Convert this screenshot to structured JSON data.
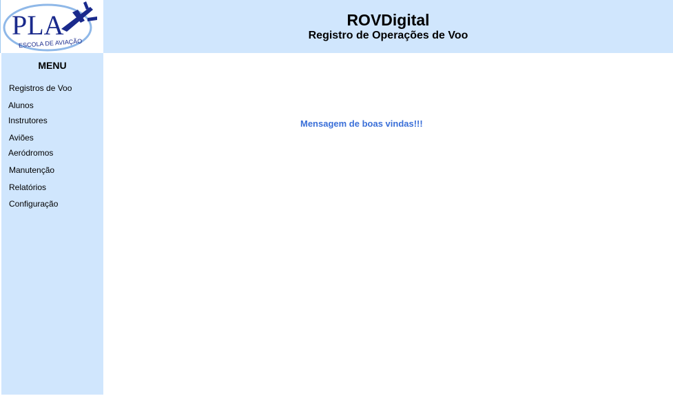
{
  "logo": {
    "text": "PLA",
    "tagline": "ESCOLA DE AVIAÇÃO",
    "icon": "airplane-icon",
    "color": "#1a2a8c",
    "ring_color": "#8fb8e8"
  },
  "header": {
    "title": "ROVDigital",
    "subtitle": "Registro de Operações de Voo"
  },
  "sidebar": {
    "title": "MENU",
    "items": [
      {
        "label": "Registros de Voo"
      },
      {
        "label": "Alunos"
      },
      {
        "label": "Instrutores"
      },
      {
        "label": "Aviões"
      },
      {
        "label": "Aeródromos"
      },
      {
        "label": "Manutenção"
      },
      {
        "label": "Relatórios"
      },
      {
        "label": "Configuração"
      }
    ]
  },
  "main": {
    "welcome": "Mensagem de boas vindas!!!"
  },
  "colors": {
    "panel": "#d0e6fd",
    "welcome": "#3a6fd8"
  }
}
